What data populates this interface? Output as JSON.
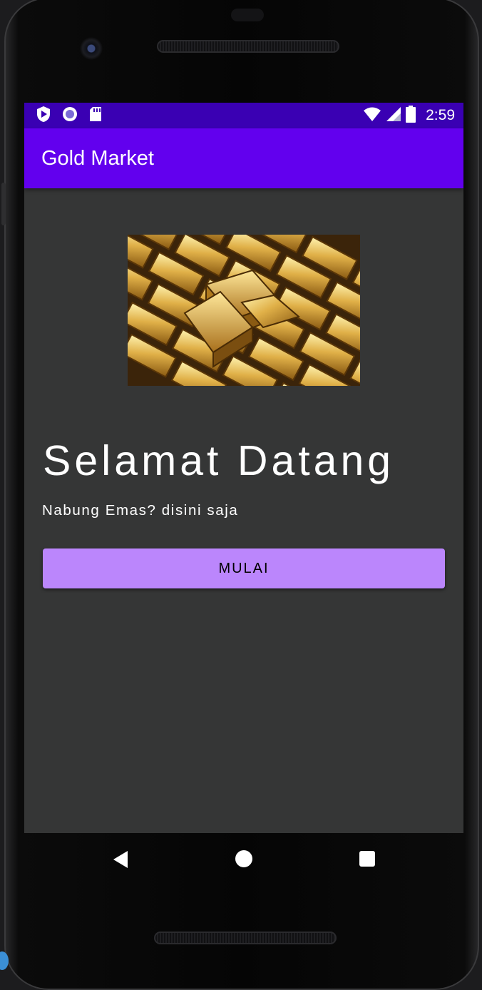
{
  "status_bar": {
    "time": "2:59",
    "icons_left": [
      "play-protect-icon",
      "circle-notification-icon",
      "sd-card-icon"
    ],
    "icons_right": [
      "wifi-icon",
      "cell-signal-icon",
      "battery-icon"
    ]
  },
  "app_bar": {
    "title": "Gold Market"
  },
  "main": {
    "image": "gold-bars-image",
    "heading": "Selamat Datang",
    "subtitle": "Nabung Emas? disini saja",
    "start_button_label": "MULAI"
  },
  "nav_bar": {
    "buttons": [
      "back-icon",
      "home-icon",
      "recents-icon"
    ]
  },
  "colors": {
    "status_bar": "#3a00b3",
    "app_bar": "#6200ee",
    "background": "#353636",
    "button": "#bb86fc",
    "text": "#ffffff"
  }
}
